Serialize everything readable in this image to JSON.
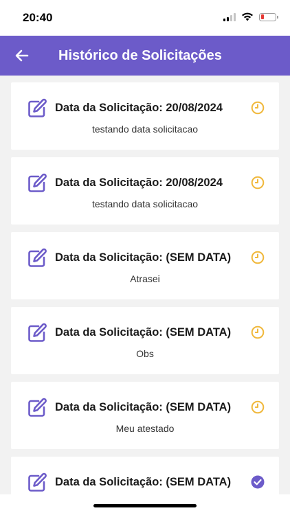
{
  "status_bar": {
    "time": "20:40"
  },
  "header": {
    "title": "Histórico de Solicitações",
    "back_icon": "arrow-left-icon"
  },
  "colors": {
    "accent": "#6c5bc9",
    "pending": "#f0b83c",
    "done": "#6c5bc9"
  },
  "requests": [
    {
      "title": "Data da Solicitação: 20/08/2024",
      "note": "testando data solicitacao",
      "status": "pending",
      "status_icon": "clock-icon"
    },
    {
      "title": "Data da Solicitação: 20/08/2024",
      "note": "testando data solicitacao",
      "status": "pending",
      "status_icon": "clock-icon"
    },
    {
      "title": "Data da Solicitação: (SEM DATA)",
      "note": "Atrasei",
      "status": "pending",
      "status_icon": "clock-icon"
    },
    {
      "title": "Data da Solicitação: (SEM DATA)",
      "note": "Obs",
      "status": "pending",
      "status_icon": "clock-icon"
    },
    {
      "title": "Data da Solicitação: (SEM DATA)",
      "note": "Meu atestado",
      "status": "pending",
      "status_icon": "clock-icon"
    },
    {
      "title": "Data da Solicitação: (SEM DATA)",
      "note": "",
      "status": "done",
      "status_icon": "check-circle-icon"
    }
  ]
}
